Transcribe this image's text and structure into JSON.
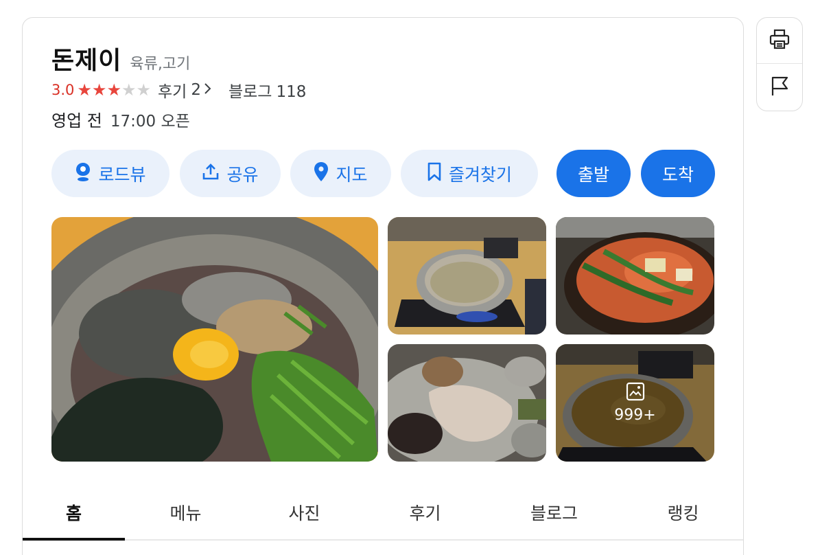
{
  "place": {
    "name": "돈제이",
    "category": "육류,고기",
    "rating": "3.0",
    "rating_stars": 3,
    "rating_max": 5,
    "reviews_label": "후기",
    "reviews_count": "2",
    "blog_label": "블로그",
    "blog_count": "118",
    "hours_status": "영업 전",
    "hours_time": "17:00 오픈"
  },
  "actions": [
    {
      "label": "로드뷰",
      "icon": "roadview-icon"
    },
    {
      "label": "공유",
      "icon": "share-icon"
    },
    {
      "label": "지도",
      "icon": "map-pin-icon"
    },
    {
      "label": "즐겨찾기",
      "icon": "bookmark-icon"
    },
    {
      "label": "출발"
    },
    {
      "label": "도착"
    }
  ],
  "photos": {
    "more_count": "999+",
    "items": [
      {
        "name": "bibim-noodles-photo"
      },
      {
        "name": "pot-on-stove-photo"
      },
      {
        "name": "stew-pot-photo"
      },
      {
        "name": "grilled-meat-photo"
      },
      {
        "name": "soup-pot-photo"
      }
    ]
  },
  "tabs": [
    {
      "label": "홈",
      "active": true
    },
    {
      "label": "메뉴"
    },
    {
      "label": "사진"
    },
    {
      "label": "후기"
    },
    {
      "label": "블로그"
    },
    {
      "label": "랭킹"
    }
  ],
  "colors": {
    "accent": "#1a73e8",
    "accent_light": "#eaf1fb",
    "rating_red": "#d93025",
    "star_on": "#e8453c",
    "star_off": "#d0d0d0"
  }
}
